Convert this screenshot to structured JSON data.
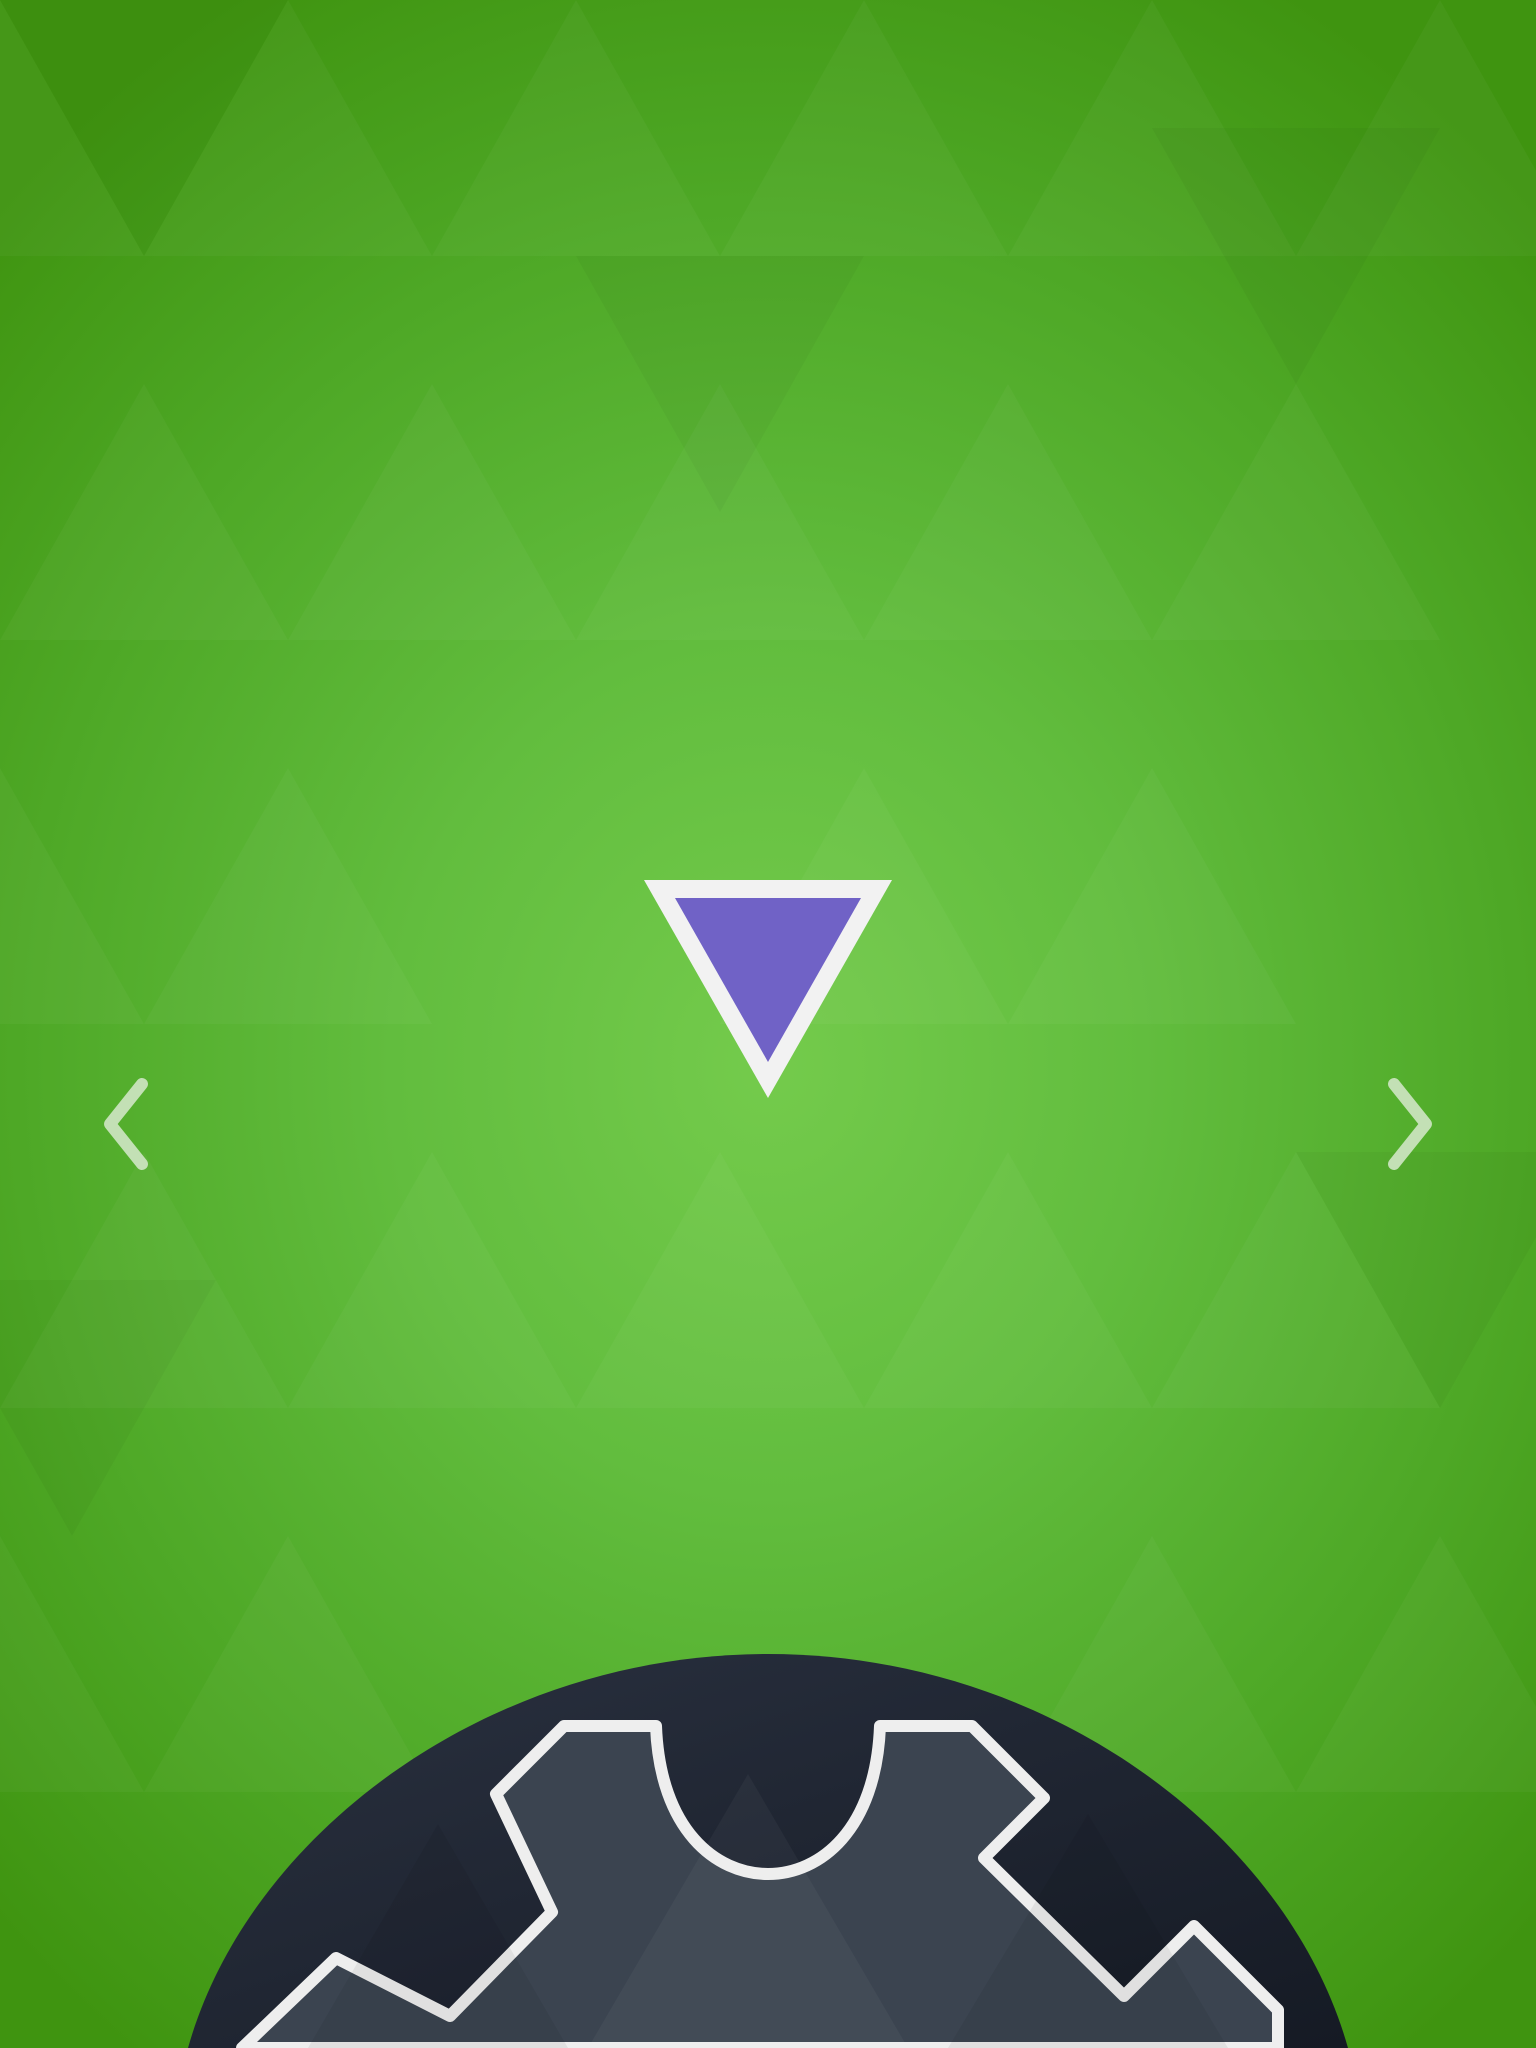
{
  "screen": {
    "background_colors": [
      "#74cb4c",
      "#4ea826",
      "#3f9410"
    ]
  },
  "navigation": {
    "prev_icon": "chevron-left-icon",
    "next_icon": "chevron-right-icon",
    "arrow_color": "#cfe5c4"
  },
  "piece": {
    "shape": "triangle-down",
    "fill_color": "#7062c6",
    "outline_color": "#f2f2f2"
  },
  "board": {
    "icon": "gear-icon",
    "disc_color": "#1f2430",
    "gear_color": "#3b4450",
    "outline_color": "#eeeeee"
  }
}
